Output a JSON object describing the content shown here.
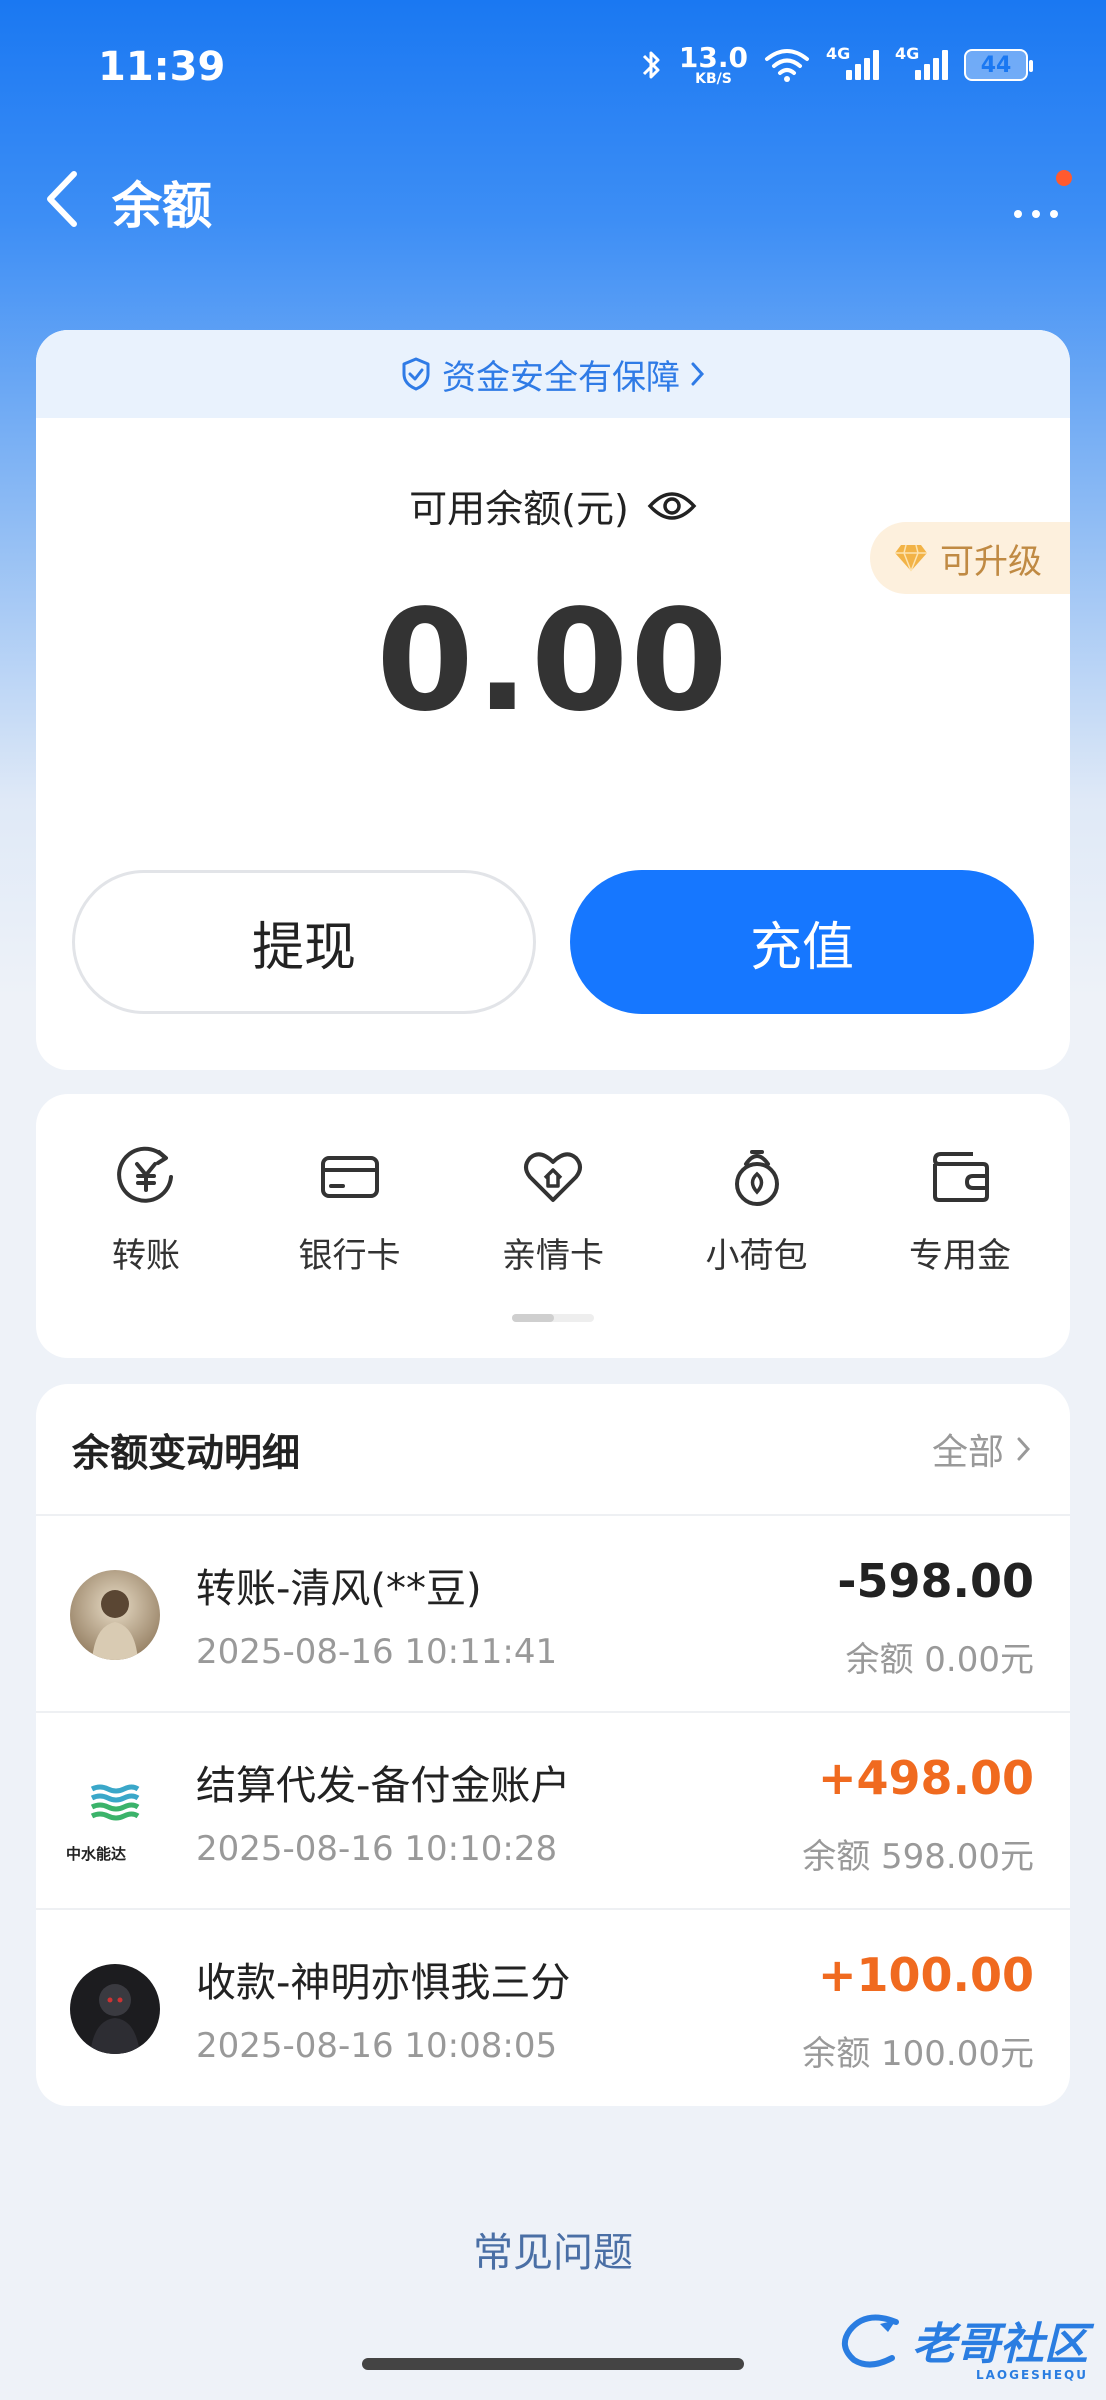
{
  "status_bar": {
    "time": "11:39",
    "net_speed_value": "13.0",
    "net_speed_unit": "KB/S",
    "signal1_label": "4G",
    "signal2_label": "4G",
    "battery": "44"
  },
  "header": {
    "title": "余额"
  },
  "balance_card": {
    "security_text": "资金安全有保障",
    "label": "可用余额(元)",
    "amount": "0.00",
    "upgrade_label": "可升级",
    "withdraw_label": "提现",
    "recharge_label": "充值"
  },
  "services": {
    "items": [
      {
        "label": "转账",
        "icon": "transfer-yuan-icon"
      },
      {
        "label": "银行卡",
        "icon": "bank-card-icon"
      },
      {
        "label": "亲情卡",
        "icon": "family-card-icon"
      },
      {
        "label": "小荷包",
        "icon": "small-pouch-icon"
      },
      {
        "label": "专用金",
        "icon": "wallet-icon"
      }
    ]
  },
  "transactions": {
    "title": "余额变动明细",
    "filter_label": "全部",
    "rows": [
      {
        "name": "转账-清风(**豆)",
        "time": "2025-08-16 10:11:41",
        "amount": "-598.00",
        "balance": "余额 0.00元"
      },
      {
        "name": "结算代发-备付金账户",
        "time": "2025-08-16 10:10:28",
        "amount": "+498.00",
        "balance": "余额 598.00元"
      },
      {
        "name": "收款-神明亦惧我三分",
        "time": "2025-08-16 10:08:05",
        "amount": "+100.00",
        "balance": "余额 100.00元"
      }
    ],
    "logo_text": "中水能达"
  },
  "faq_label": "常见问题",
  "watermark": {
    "text": "老哥社区",
    "sub": "LAOGESHEQU"
  },
  "colors": {
    "primary_blue": "#1677ff",
    "positive_orange": "#f06a1f",
    "upgrade_gold": "#c08a43"
  }
}
